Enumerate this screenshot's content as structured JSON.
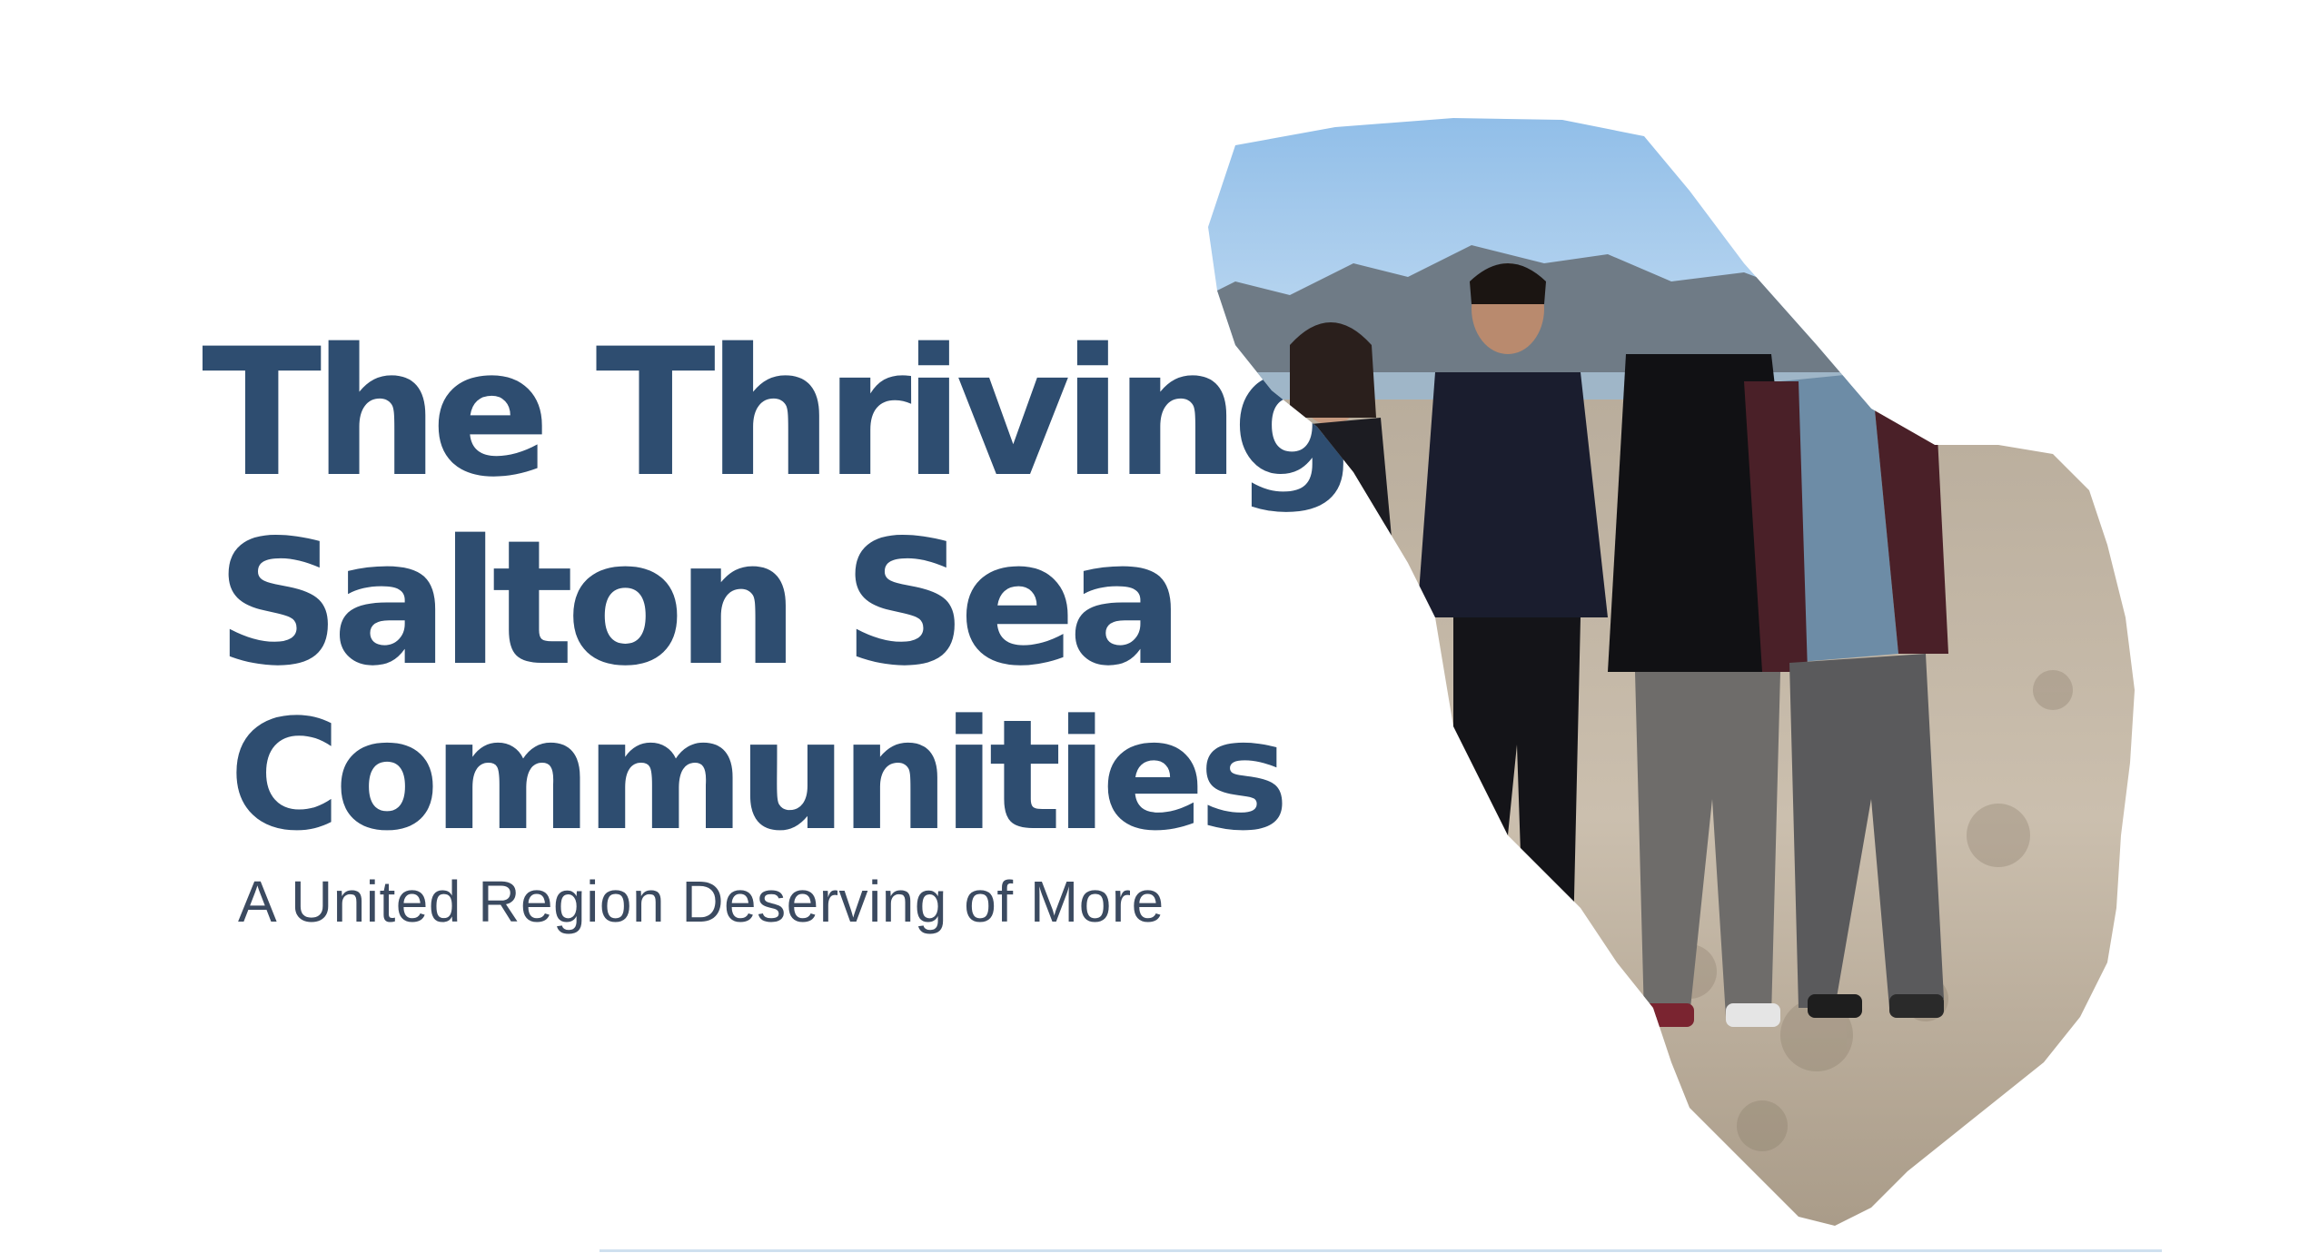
{
  "heading": {
    "line1": "The Thriving",
    "line2": "Salton Sea",
    "line3": "Communities"
  },
  "subtitle": "A United Region Deserving of More",
  "colors": {
    "heading": "#2e4d70",
    "subtitle": "#3b4a60",
    "sky": "#a9cdee",
    "ground": "#c9bca9"
  }
}
